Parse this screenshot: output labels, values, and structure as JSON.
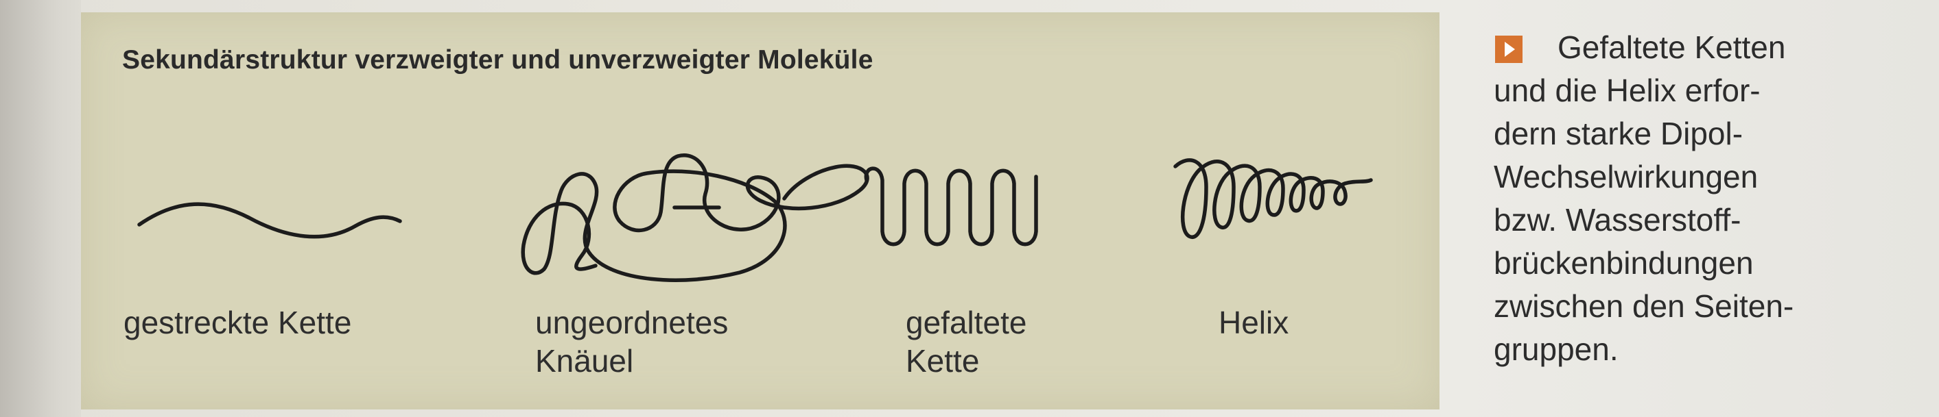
{
  "panel": {
    "title": "Sekundärstruktur verzweigter und unverzweigter Moleküle",
    "structures": [
      {
        "id": "stretched",
        "label_lines": [
          "gestreckte Kette"
        ]
      },
      {
        "id": "coil",
        "label_lines": [
          "ungeordnetes",
          "Knäuel"
        ]
      },
      {
        "id": "folded",
        "label_lines": [
          "gefaltete",
          "Kette"
        ]
      },
      {
        "id": "helix",
        "label_lines": [
          "Helix"
        ]
      }
    ]
  },
  "sidebar": {
    "icon": "orange-triangle-marker",
    "accent_color": "#d7732f",
    "lines": [
      "Gefaltete Ketten",
      "und die Helix erfor-",
      "dern starke Dipol-",
      "Wechselwirkungen",
      "bzw. Wasserstoff-",
      "brückenbindungen",
      "zwischen den Seiten-",
      "gruppen."
    ]
  }
}
